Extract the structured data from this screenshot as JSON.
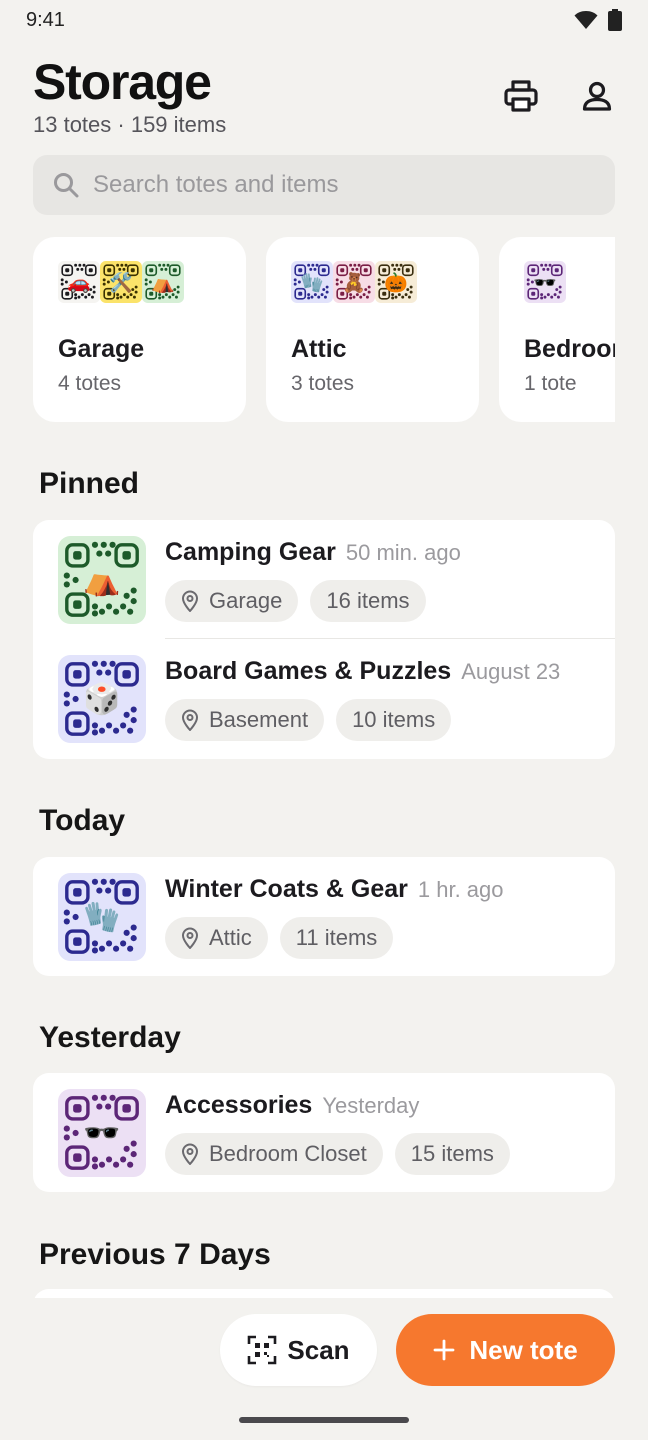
{
  "status_bar": {
    "time": "9:41"
  },
  "header": {
    "title": "Storage",
    "subtitle": "13 totes · 159 items",
    "print_icon": "printer-icon",
    "profile_icon": "person-icon"
  },
  "search": {
    "placeholder": "Search totes and items"
  },
  "locations": [
    {
      "name": "Garage",
      "count": "4 totes",
      "qrs": [
        {
          "emoji": "🚗",
          "bg": "#f5f4f1",
          "fg": "#1c1b1f"
        },
        {
          "emoji": "🛠️",
          "bg": "#fbe36a",
          "fg": "#3a3100"
        },
        {
          "emoji": "⛺",
          "bg": "#d6efd6",
          "fg": "#1d5a2a"
        }
      ]
    },
    {
      "name": "Attic",
      "count": "3 totes",
      "qrs": [
        {
          "emoji": "🧤",
          "bg": "#e2e3fb",
          "fg": "#2c2a8f"
        },
        {
          "emoji": "🧸",
          "bg": "#f7dde6",
          "fg": "#7a1e45"
        },
        {
          "emoji": "🎃",
          "bg": "#f6ecd7",
          "fg": "#3a2e10"
        }
      ]
    },
    {
      "name": "Bedroom",
      "count": "1 tote",
      "qrs": [
        {
          "emoji": "🕶️",
          "bg": "#ece0f4",
          "fg": "#5c2677"
        }
      ]
    }
  ],
  "sections": {
    "pinned": "Pinned",
    "today": "Today",
    "yesterday": "Yesterday",
    "previous": "Previous 7 Days"
  },
  "totes": {
    "pinned": [
      {
        "name": "Camping Gear",
        "time": "50 min. ago",
        "location": "Garage",
        "items": "16 items",
        "emoji": "⛺",
        "bg": "#d6efd6",
        "fg": "#1d5a2a"
      },
      {
        "name": "Board Games & Puzzles",
        "time": "August 23",
        "location": "Basement",
        "items": "10 items",
        "emoji": "🎲",
        "bg": "#e2e3fb",
        "fg": "#2c2a8f"
      }
    ],
    "today": [
      {
        "name": "Winter Coats & Gear",
        "time": "1 hr. ago",
        "location": "Attic",
        "items": "11 items",
        "emoji": "🧤",
        "bg": "#e2e3fb",
        "fg": "#2c2a8f"
      }
    ],
    "yesterday": [
      {
        "name": "Accessories",
        "time": "Yesterday",
        "location": "Bedroom Closet",
        "items": "15 items",
        "emoji": "🕶️",
        "bg": "#ece0f4",
        "fg": "#5c2677"
      }
    ]
  },
  "actions": {
    "scan_label": "Scan",
    "new_label": "New tote",
    "accent": "#f6782e"
  }
}
